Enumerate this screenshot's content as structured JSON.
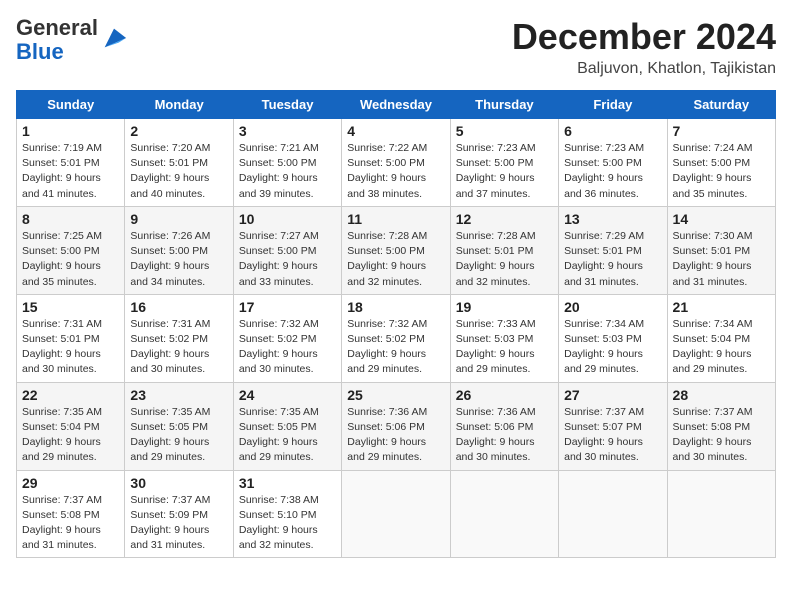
{
  "logo": {
    "general": "General",
    "blue": "Blue"
  },
  "header": {
    "month": "December 2024",
    "location": "Baljuvon, Khatlon, Tajikistan"
  },
  "weekdays": [
    "Sunday",
    "Monday",
    "Tuesday",
    "Wednesday",
    "Thursday",
    "Friday",
    "Saturday"
  ],
  "weeks": [
    [
      {
        "day": "1",
        "content": "Sunrise: 7:19 AM\nSunset: 5:01 PM\nDaylight: 9 hours\nand 41 minutes."
      },
      {
        "day": "2",
        "content": "Sunrise: 7:20 AM\nSunset: 5:01 PM\nDaylight: 9 hours\nand 40 minutes."
      },
      {
        "day": "3",
        "content": "Sunrise: 7:21 AM\nSunset: 5:00 PM\nDaylight: 9 hours\nand 39 minutes."
      },
      {
        "day": "4",
        "content": "Sunrise: 7:22 AM\nSunset: 5:00 PM\nDaylight: 9 hours\nand 38 minutes."
      },
      {
        "day": "5",
        "content": "Sunrise: 7:23 AM\nSunset: 5:00 PM\nDaylight: 9 hours\nand 37 minutes."
      },
      {
        "day": "6",
        "content": "Sunrise: 7:23 AM\nSunset: 5:00 PM\nDaylight: 9 hours\nand 36 minutes."
      },
      {
        "day": "7",
        "content": "Sunrise: 7:24 AM\nSunset: 5:00 PM\nDaylight: 9 hours\nand 35 minutes."
      }
    ],
    [
      {
        "day": "8",
        "content": "Sunrise: 7:25 AM\nSunset: 5:00 PM\nDaylight: 9 hours\nand 35 minutes."
      },
      {
        "day": "9",
        "content": "Sunrise: 7:26 AM\nSunset: 5:00 PM\nDaylight: 9 hours\nand 34 minutes."
      },
      {
        "day": "10",
        "content": "Sunrise: 7:27 AM\nSunset: 5:00 PM\nDaylight: 9 hours\nand 33 minutes."
      },
      {
        "day": "11",
        "content": "Sunrise: 7:28 AM\nSunset: 5:00 PM\nDaylight: 9 hours\nand 32 minutes."
      },
      {
        "day": "12",
        "content": "Sunrise: 7:28 AM\nSunset: 5:01 PM\nDaylight: 9 hours\nand 32 minutes."
      },
      {
        "day": "13",
        "content": "Sunrise: 7:29 AM\nSunset: 5:01 PM\nDaylight: 9 hours\nand 31 minutes."
      },
      {
        "day": "14",
        "content": "Sunrise: 7:30 AM\nSunset: 5:01 PM\nDaylight: 9 hours\nand 31 minutes."
      }
    ],
    [
      {
        "day": "15",
        "content": "Sunrise: 7:31 AM\nSunset: 5:01 PM\nDaylight: 9 hours\nand 30 minutes."
      },
      {
        "day": "16",
        "content": "Sunrise: 7:31 AM\nSunset: 5:02 PM\nDaylight: 9 hours\nand 30 minutes."
      },
      {
        "day": "17",
        "content": "Sunrise: 7:32 AM\nSunset: 5:02 PM\nDaylight: 9 hours\nand 30 minutes."
      },
      {
        "day": "18",
        "content": "Sunrise: 7:32 AM\nSunset: 5:02 PM\nDaylight: 9 hours\nand 29 minutes."
      },
      {
        "day": "19",
        "content": "Sunrise: 7:33 AM\nSunset: 5:03 PM\nDaylight: 9 hours\nand 29 minutes."
      },
      {
        "day": "20",
        "content": "Sunrise: 7:34 AM\nSunset: 5:03 PM\nDaylight: 9 hours\nand 29 minutes."
      },
      {
        "day": "21",
        "content": "Sunrise: 7:34 AM\nSunset: 5:04 PM\nDaylight: 9 hours\nand 29 minutes."
      }
    ],
    [
      {
        "day": "22",
        "content": "Sunrise: 7:35 AM\nSunset: 5:04 PM\nDaylight: 9 hours\nand 29 minutes."
      },
      {
        "day": "23",
        "content": "Sunrise: 7:35 AM\nSunset: 5:05 PM\nDaylight: 9 hours\nand 29 minutes."
      },
      {
        "day": "24",
        "content": "Sunrise: 7:35 AM\nSunset: 5:05 PM\nDaylight: 9 hours\nand 29 minutes."
      },
      {
        "day": "25",
        "content": "Sunrise: 7:36 AM\nSunset: 5:06 PM\nDaylight: 9 hours\nand 29 minutes."
      },
      {
        "day": "26",
        "content": "Sunrise: 7:36 AM\nSunset: 5:06 PM\nDaylight: 9 hours\nand 30 minutes."
      },
      {
        "day": "27",
        "content": "Sunrise: 7:37 AM\nSunset: 5:07 PM\nDaylight: 9 hours\nand 30 minutes."
      },
      {
        "day": "28",
        "content": "Sunrise: 7:37 AM\nSunset: 5:08 PM\nDaylight: 9 hours\nand 30 minutes."
      }
    ],
    [
      {
        "day": "29",
        "content": "Sunrise: 7:37 AM\nSunset: 5:08 PM\nDaylight: 9 hours\nand 31 minutes."
      },
      {
        "day": "30",
        "content": "Sunrise: 7:37 AM\nSunset: 5:09 PM\nDaylight: 9 hours\nand 31 minutes."
      },
      {
        "day": "31",
        "content": "Sunrise: 7:38 AM\nSunset: 5:10 PM\nDaylight: 9 hours\nand 32 minutes."
      },
      null,
      null,
      null,
      null
    ]
  ]
}
